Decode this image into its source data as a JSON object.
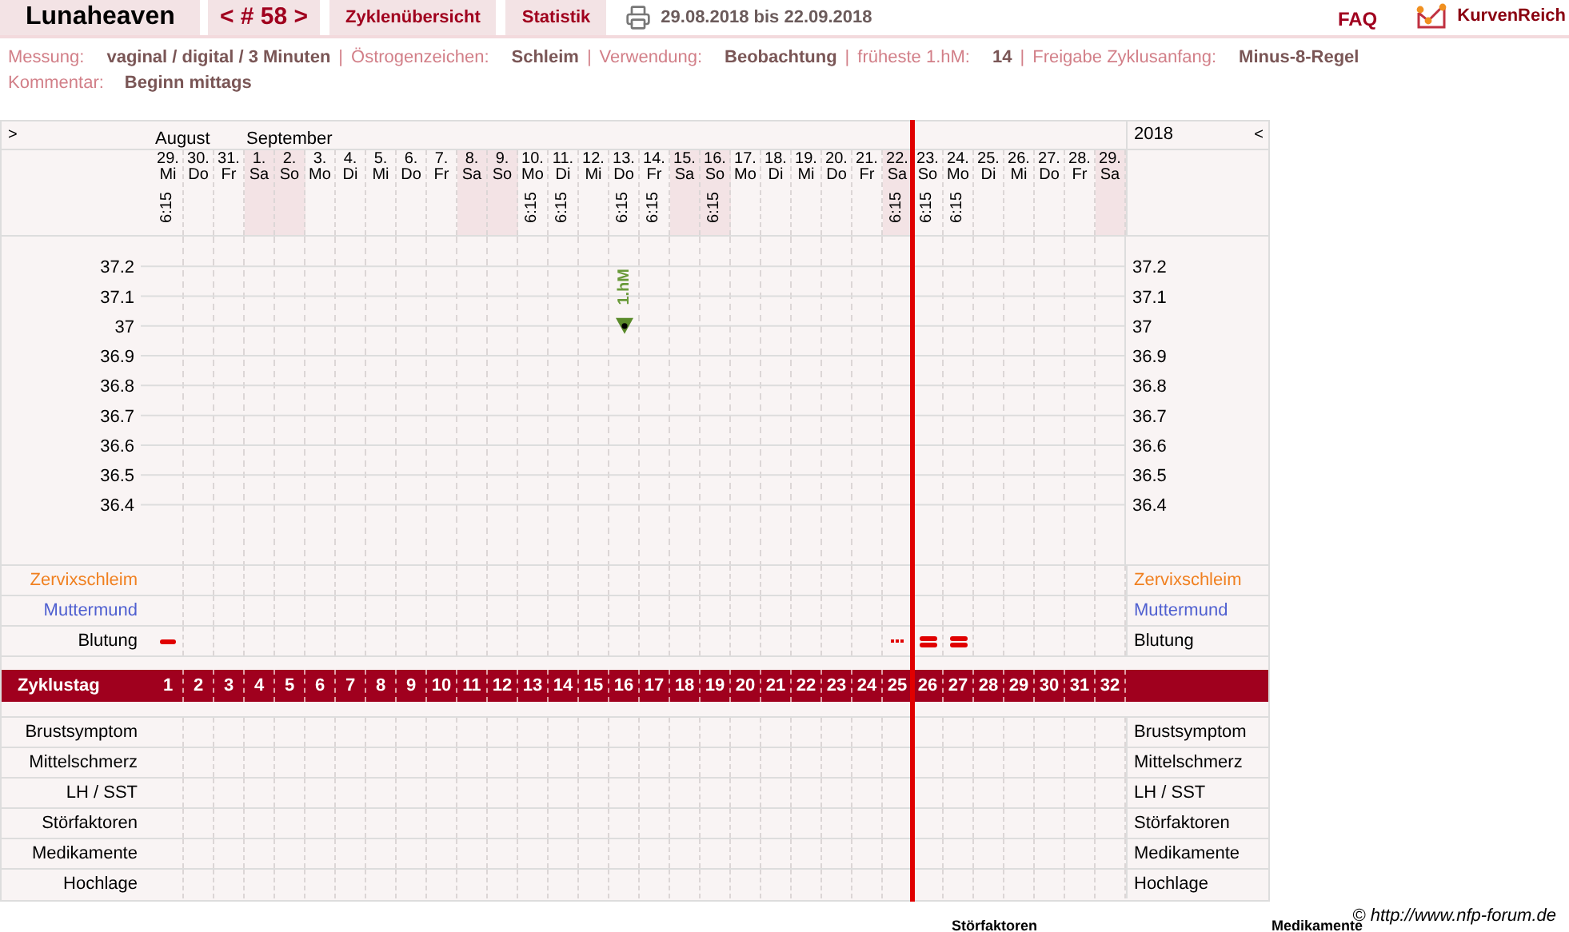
{
  "header": {
    "user": "Lunaheaven",
    "cycle_nav": "< # 58 >",
    "tabs": [
      {
        "label": "Zyklenübersicht"
      },
      {
        "label": "Statistik"
      }
    ],
    "date_range": "29.08.2018 bis 22.09.2018",
    "faq": "FAQ",
    "logo": "KurvenReich"
  },
  "info": {
    "separator": "|",
    "items": [
      {
        "label": "Messung:",
        "value": "vaginal / digital / 3 Minuten"
      },
      {
        "label": "Östrogenzeichen:",
        "value": "Schleim"
      },
      {
        "label": "Verwendung:",
        "value": "Beobachtung"
      },
      {
        "label": "früheste 1.hM:",
        "value": "14"
      },
      {
        "label": "Freigabe Zyklusanfang:",
        "value": "Minus-8-Regel"
      }
    ],
    "comment": {
      "label": "Kommentar:",
      "value": "Beginn mittags"
    }
  },
  "table": {
    "prev": ">",
    "next": "<",
    "year": "2018",
    "days": [
      {
        "date": "29.",
        "weekday": "Mi",
        "month": "August",
        "time": "6:15",
        "shaded": false,
        "current": false,
        "bleeding": {
          "kind": "light"
        }
      },
      {
        "date": "30.",
        "weekday": "Do",
        "shaded": false,
        "current": false
      },
      {
        "date": "31.",
        "weekday": "Fr",
        "shaded": false,
        "current": false
      },
      {
        "date": "1.",
        "weekday": "Sa",
        "month": "September",
        "shaded": true,
        "current": false
      },
      {
        "date": "2.",
        "weekday": "So",
        "shaded": true,
        "current": false
      },
      {
        "date": "3.",
        "weekday": "Mo",
        "shaded": false,
        "current": false
      },
      {
        "date": "4.",
        "weekday": "Di",
        "shaded": false,
        "current": false
      },
      {
        "date": "5.",
        "weekday": "Mi",
        "shaded": false,
        "current": false
      },
      {
        "date": "6.",
        "weekday": "Do",
        "shaded": false,
        "current": false
      },
      {
        "date": "7.",
        "weekday": "Fr",
        "shaded": false,
        "current": false
      },
      {
        "date": "8.",
        "weekday": "Sa",
        "shaded": true,
        "current": false
      },
      {
        "date": "9.",
        "weekday": "So",
        "shaded": true,
        "current": false
      },
      {
        "date": "10.",
        "weekday": "Mo",
        "time": "6:15",
        "shaded": false,
        "current": false
      },
      {
        "date": "11.",
        "weekday": "Di",
        "time": "6:15",
        "shaded": false,
        "current": false
      },
      {
        "date": "12.",
        "weekday": "Mi",
        "shaded": false,
        "current": false
      },
      {
        "date": "13.",
        "weekday": "Do",
        "time": "6:15",
        "shaded": false,
        "current": false
      },
      {
        "date": "14.",
        "weekday": "Fr",
        "time": "6:15",
        "shaded": false,
        "current": false
      },
      {
        "date": "15.",
        "weekday": "Sa",
        "shaded": true,
        "current": false
      },
      {
        "date": "16.",
        "weekday": "So",
        "time": "6:15",
        "shaded": true,
        "current": false
      },
      {
        "date": "17.",
        "weekday": "Mo",
        "shaded": false,
        "current": false
      },
      {
        "date": "18.",
        "weekday": "Di",
        "shaded": false,
        "current": false
      },
      {
        "date": "19.",
        "weekday": "Mi",
        "shaded": false,
        "current": false
      },
      {
        "date": "20.",
        "weekday": "Do",
        "shaded": false,
        "current": false
      },
      {
        "date": "21.",
        "weekday": "Fr",
        "shaded": false,
        "current": false
      },
      {
        "date": "22.",
        "weekday": "Sa",
        "time": "6:15",
        "shaded": true,
        "current": false,
        "bleeding": {
          "kind": "spotting"
        }
      },
      {
        "date": "23.",
        "weekday": "So",
        "time": "6:15",
        "shaded": false,
        "current": true,
        "bleeding": {
          "kind": "medium"
        }
      },
      {
        "date": "24.",
        "weekday": "Mo",
        "time": "6:15",
        "shaded": false,
        "current": false,
        "bleeding": {
          "kind": "medium"
        }
      },
      {
        "date": "25.",
        "weekday": "Di",
        "shaded": false,
        "current": false
      },
      {
        "date": "26.",
        "weekday": "Mi",
        "shaded": false,
        "current": false
      },
      {
        "date": "27.",
        "weekday": "Do",
        "shaded": false,
        "current": false
      },
      {
        "date": "28.",
        "weekday": "Fr",
        "shaded": false,
        "current": false
      },
      {
        "date": "29.",
        "weekday": "Sa",
        "shaded": true,
        "current": false
      }
    ],
    "chart_data": {
      "type": "scatter",
      "grid": true,
      "ylim": [
        36.2,
        37.3
      ],
      "series": [
        {
          "color": "#5a8a2a",
          "values": [
            null,
            null,
            null,
            null,
            null,
            null,
            null,
            null,
            null,
            null,
            null,
            null,
            null,
            null,
            null,
            37,
            null,
            null,
            null,
            null,
            null,
            null,
            null,
            null,
            null,
            null,
            null,
            null,
            null,
            null,
            null,
            null
          ]
        }
      ],
      "yticks": [
        37.2,
        37.1,
        {
          "value": 37,
          "label": "37"
        },
        36.9,
        36.8,
        36.7,
        36.6,
        36.5,
        36.4
      ],
      "annotations": [
        {
          "y": 37,
          "text": "1.hM"
        }
      ]
    },
    "cycle_days": [
      "1",
      "2",
      "3",
      "4",
      "5",
      "6",
      "7",
      "8",
      "9",
      "10",
      "11",
      "12",
      "13",
      "14",
      "15",
      "16",
      "17",
      "18",
      "19",
      "20",
      "21",
      "22",
      "23",
      "24",
      "25",
      "26",
      "27",
      "28",
      "29",
      "30",
      "31",
      "32"
    ],
    "right_ticks": [
      "37.2",
      "37.1",
      "37",
      "36.9",
      "36.8",
      "36.7",
      "36.6",
      "36.5",
      "36.4"
    ],
    "observation_rows": [
      {
        "label": "Zervixschleim",
        "label_right": "Zervixschleim",
        "kind": "mucus"
      },
      {
        "label": "Muttermund",
        "label_right": "Muttermund",
        "kind": "cervix"
      },
      {
        "label": "Blutung",
        "label_right": "Blutung",
        "kind": "bleeding"
      }
    ],
    "cycle_label": "Zyklustag",
    "symptom_rows": [
      {
        "label": "Brustsymptom",
        "label_right": "Brustsymptom"
      },
      {
        "label": "Mittelschmerz",
        "label_right": "Mittelschmerz"
      },
      {
        "label": "LH / SST",
        "label_right": "LH / SST"
      },
      {
        "label": "Störfaktoren",
        "label_right": "Störfaktoren"
      },
      {
        "label": "Medikamente",
        "label_right": "Medikamente"
      },
      {
        "label": "Hochlage",
        "label_right": "Hochlage"
      }
    ]
  },
  "copyright": "© http://www.nfp-forum.de",
  "footer_headings": [
    "Störfaktoren",
    "Medikamente"
  ]
}
